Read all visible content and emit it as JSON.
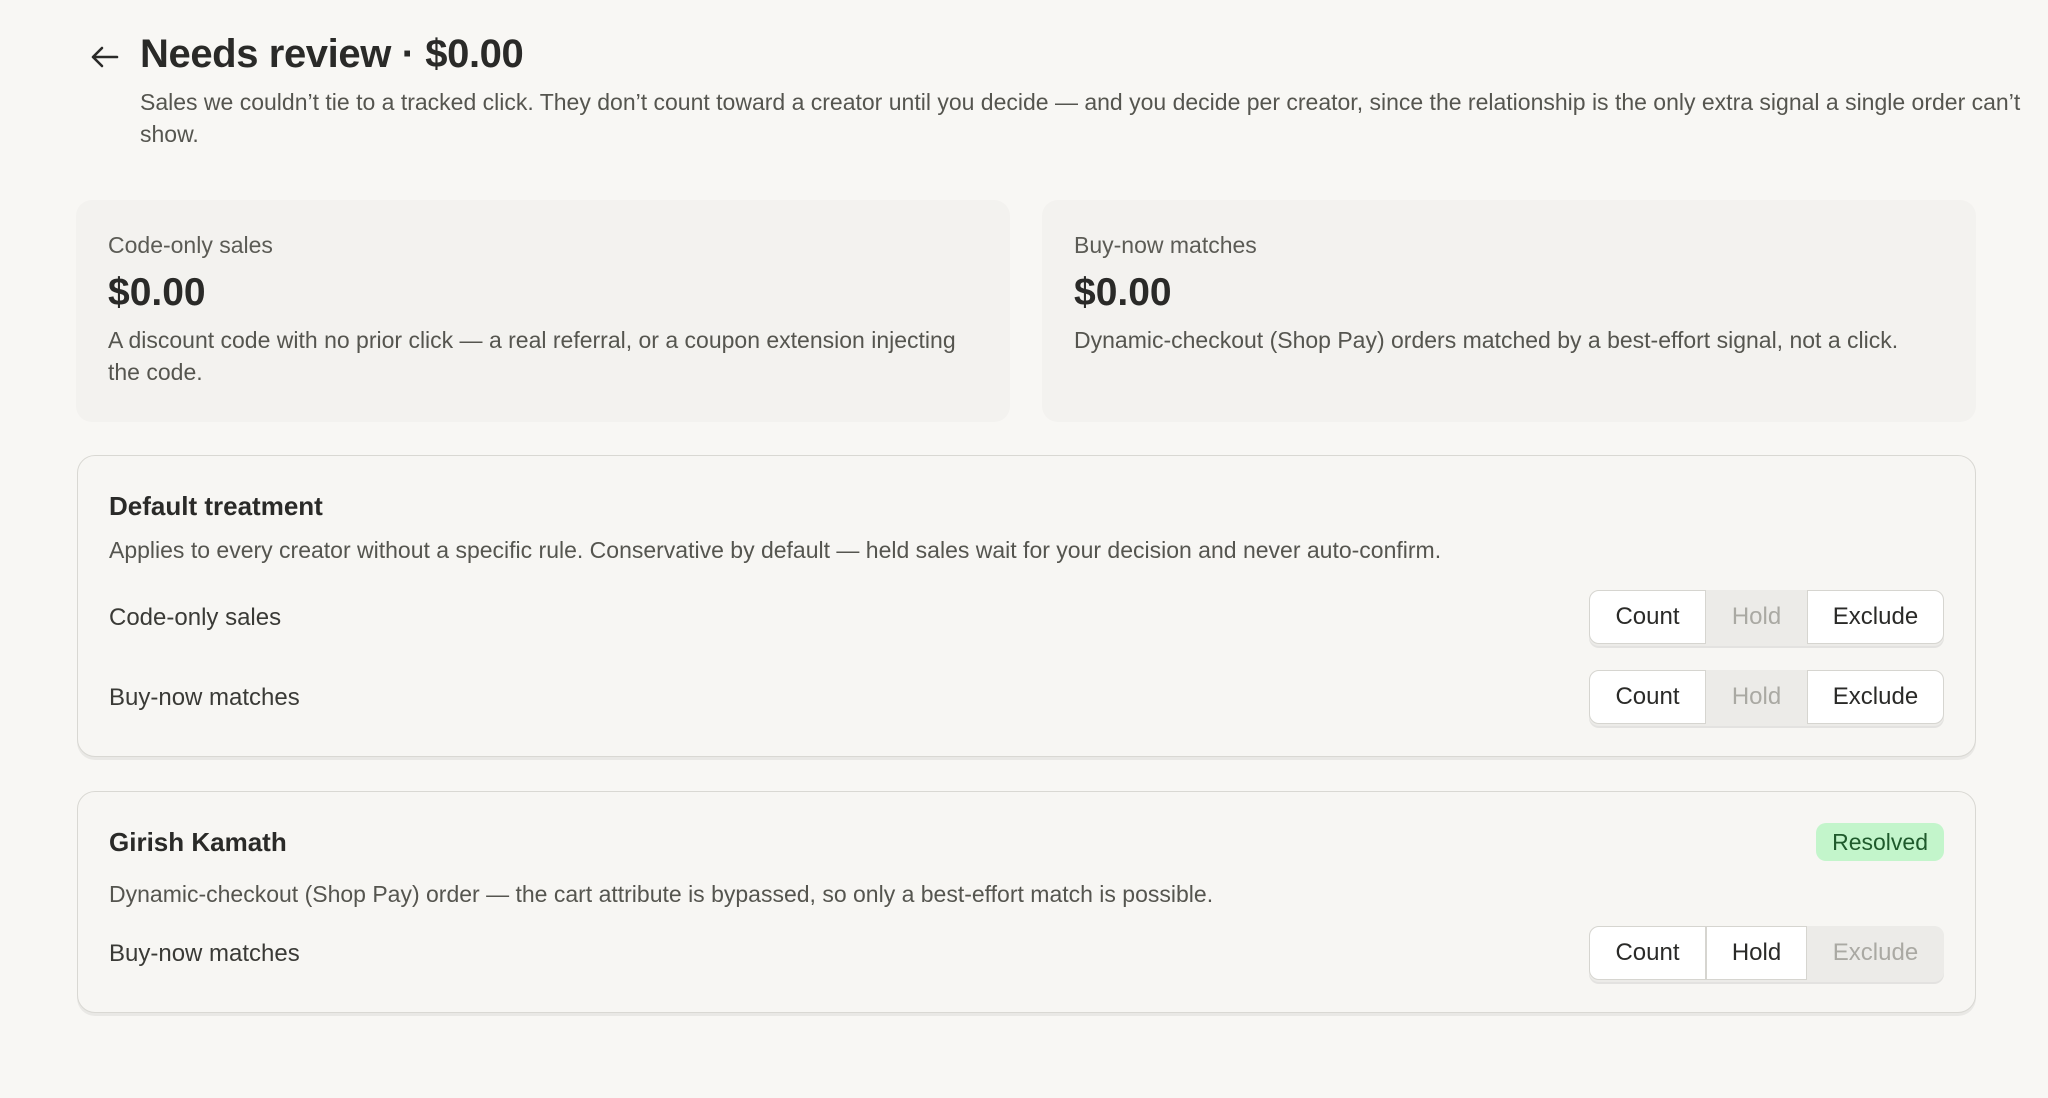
{
  "header": {
    "back_icon": "arrow-left-icon",
    "title": "Needs review · $0.00",
    "subtitle": "Sales we couldn’t tie to a tracked click. They don’t count toward a creator until you decide — and you decide per creator, since the relationship is the only extra signal a single order can’t show."
  },
  "stats": [
    {
      "label": "Code-only sales",
      "value": "$0.00",
      "description": "A discount code with no prior click — a real referral, or a coupon extension injecting the code."
    },
    {
      "label": "Buy-now matches",
      "value": "$0.00",
      "description": "Dynamic-checkout (Shop Pay) orders matched by a best-effort signal, not a click."
    }
  ],
  "default_treatment": {
    "title": "Default treatment",
    "description": "Applies to every creator without a specific rule. Conservative by default — held sales wait for your decision and never auto-confirm.",
    "rows": [
      {
        "label": "Code-only sales",
        "options": [
          "Count",
          "Hold",
          "Exclude"
        ],
        "selected": "Hold"
      },
      {
        "label": "Buy-now matches",
        "options": [
          "Count",
          "Hold",
          "Exclude"
        ],
        "selected": "Hold"
      }
    ]
  },
  "creator": {
    "name": "Girish Kamath",
    "status": "Resolved",
    "status_color": "#c3f5cb",
    "description": "Dynamic-checkout (Shop Pay) order — the cart attribute is bypassed, so only a best-effort match is possible.",
    "row": {
      "label": "Buy-now matches",
      "options": [
        "Count",
        "Hold",
        "Exclude"
      ],
      "selected": "Exclude"
    }
  }
}
